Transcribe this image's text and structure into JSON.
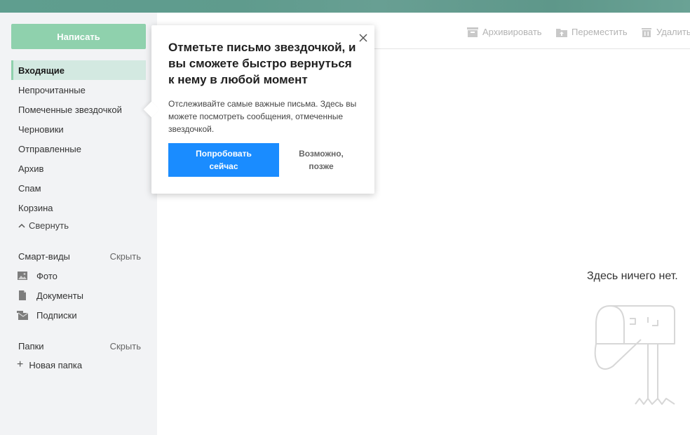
{
  "sidebar": {
    "compose_label": "Написать",
    "folders": [
      {
        "label": "Входящие",
        "active": true
      },
      {
        "label": "Непрочитанные"
      },
      {
        "label": "Помеченные звездочкой"
      },
      {
        "label": "Черновики"
      },
      {
        "label": "Отправленные"
      },
      {
        "label": "Архив"
      },
      {
        "label": "Спам"
      },
      {
        "label": "Корзина"
      }
    ],
    "collapse_label": "Свернуть",
    "smart_views": {
      "title": "Смарт-виды",
      "hide_label": "Скрыть",
      "items": [
        {
          "label": "Фото",
          "icon": "photo-icon"
        },
        {
          "label": "Документы",
          "icon": "document-icon"
        },
        {
          "label": "Подписки",
          "icon": "subscriptions-icon"
        }
      ]
    },
    "folders_section": {
      "title": "Папки",
      "hide_label": "Скрыть",
      "new_folder_label": "Новая папка"
    }
  },
  "toolbar": {
    "archive_label": "Архивировать",
    "move_label": "Переместить",
    "delete_label": "Удалить"
  },
  "main": {
    "empty_text": "Здесь ничего нет."
  },
  "popover": {
    "title": "Отметьте письмо звездочкой, и вы сможете быстро вернуться к нему в любой момент",
    "body": "Отслеживайте самые важные письма. Здесь вы можете посмотреть сообщения, отмеченные звездочкой.",
    "try_label": "Попробовать сейчас",
    "later_label": "Возможно, позже"
  },
  "colors": {
    "accent_green": "#8fd1ad",
    "active_folder_bg": "#d3e9e1",
    "primary_blue": "#1a8cff",
    "topbar": "#5f9e8f"
  }
}
